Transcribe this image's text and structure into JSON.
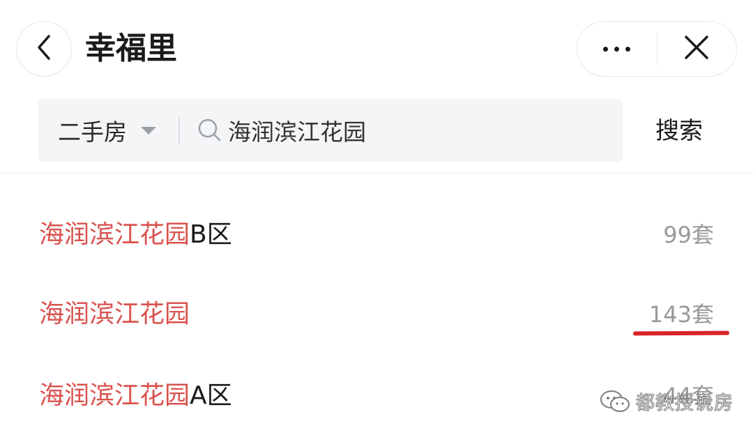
{
  "header": {
    "title": "幸福里",
    "back_icon": "chevron-left-icon",
    "more_icon": "more-dots-icon",
    "close_icon": "close-icon"
  },
  "search": {
    "category": "二手房",
    "query": "海润滨江花园",
    "submit_label": "搜索"
  },
  "results": [
    {
      "match": "海润滨江花园",
      "suffix": "B区",
      "count": "99套"
    },
    {
      "match": "海润滨江花园",
      "suffix": "",
      "count": "143套"
    },
    {
      "match": "海润滨江花园",
      "suffix": "A区",
      "count": "44套"
    }
  ],
  "watermark": {
    "text": "都教授说房",
    "icon": "wechat-icon"
  },
  "colors": {
    "highlight": "#d9534f",
    "annotation": "#d8232a"
  }
}
